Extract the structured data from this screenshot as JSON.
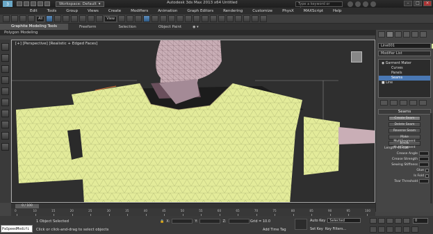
{
  "window": {
    "title": "Autodesk 3ds Max 2013 x64 Untitled",
    "workspace": "Workspace: Default",
    "search_placeholder": "Type a keyword or phrase"
  },
  "menu": [
    "Edit",
    "Tools",
    "Group",
    "Views",
    "Create",
    "Modifiers",
    "Animation",
    "Graph Editors",
    "Rendering",
    "Customize",
    "PhysX",
    "MAXScript",
    "Help"
  ],
  "toolbar": {
    "selection_filter": "All"
  },
  "ribbon": {
    "tabs": [
      "Graphite Modeling Tools",
      "Freeform",
      "Selection",
      "Object Paint"
    ],
    "panel_label": "Polygon Modeling"
  },
  "viewport": {
    "label": "[+] [Perspective] [Realistic + Edged Faces]"
  },
  "command_panel": {
    "object_name": "Line001",
    "modifier_list": "Modifier List",
    "stack": [
      {
        "label": "Garment Maker",
        "level": 0,
        "selected": false
      },
      {
        "label": "Curves",
        "level": 1,
        "selected": false
      },
      {
        "label": "Panels",
        "level": 1,
        "selected": false
      },
      {
        "label": "Seams",
        "level": 1,
        "selected": true
      },
      {
        "label": "Line",
        "level": 0,
        "selected": false
      }
    ],
    "rollout_title": "Seams",
    "buttons": [
      "Create Seam",
      "Delete Seam",
      "Reverse Seam",
      "Make MultiSegment",
      "Break MultiSegment"
    ],
    "length": "Length: 46.626",
    "params": [
      {
        "label": "Crease Angle",
        "type": "spin"
      },
      {
        "label": "Crease Strength",
        "type": "spin"
      },
      {
        "label": "Sewing Stiffness",
        "type": "spin"
      },
      {
        "label": "Glue",
        "type": "check"
      },
      {
        "label": "Is Fold",
        "type": "check"
      },
      {
        "label": "Tear Threshold",
        "type": "spin"
      }
    ]
  },
  "timeline": {
    "slider_label": "0 / 100",
    "ticks": [
      "0",
      "10",
      "15",
      "20",
      "25",
      "30",
      "35",
      "40",
      "45",
      "50",
      "55",
      "60",
      "65",
      "70",
      "75",
      "80",
      "85",
      "90",
      "95",
      "100"
    ]
  },
  "status": {
    "maxscript": "PaSpeedModifi",
    "line1": "1 Object Selected",
    "line2": "Click or click-and-drag to select objects",
    "x_label": "X:",
    "y_label": "Y:",
    "z_label": "Z:",
    "grid": "Grid = 10.0",
    "add_time_tag": "Add Time Tag",
    "auto_key": "Auto Key",
    "auto_key_value": "Selected",
    "set_key": "Set Key",
    "key_filters": "Key Filters...",
    "frame": "0"
  },
  "colors": {
    "garment": "#e3eb9a",
    "skin": "#c9aeb6",
    "selected_row": "#4a78b4"
  }
}
